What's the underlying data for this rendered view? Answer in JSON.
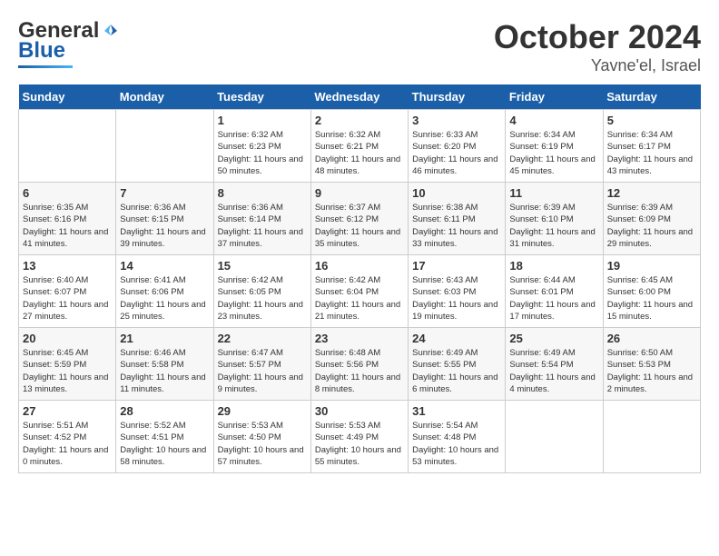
{
  "header": {
    "logo_general": "General",
    "logo_blue": "Blue",
    "month": "October 2024",
    "location": "Yavne'el, Israel"
  },
  "columns": [
    "Sunday",
    "Monday",
    "Tuesday",
    "Wednesday",
    "Thursday",
    "Friday",
    "Saturday"
  ],
  "weeks": [
    [
      {
        "day": "",
        "info": ""
      },
      {
        "day": "",
        "info": ""
      },
      {
        "day": "1",
        "info": "Sunrise: 6:32 AM\nSunset: 6:23 PM\nDaylight: 11 hours and 50 minutes."
      },
      {
        "day": "2",
        "info": "Sunrise: 6:32 AM\nSunset: 6:21 PM\nDaylight: 11 hours and 48 minutes."
      },
      {
        "day": "3",
        "info": "Sunrise: 6:33 AM\nSunset: 6:20 PM\nDaylight: 11 hours and 46 minutes."
      },
      {
        "day": "4",
        "info": "Sunrise: 6:34 AM\nSunset: 6:19 PM\nDaylight: 11 hours and 45 minutes."
      },
      {
        "day": "5",
        "info": "Sunrise: 6:34 AM\nSunset: 6:17 PM\nDaylight: 11 hours and 43 minutes."
      }
    ],
    [
      {
        "day": "6",
        "info": "Sunrise: 6:35 AM\nSunset: 6:16 PM\nDaylight: 11 hours and 41 minutes."
      },
      {
        "day": "7",
        "info": "Sunrise: 6:36 AM\nSunset: 6:15 PM\nDaylight: 11 hours and 39 minutes."
      },
      {
        "day": "8",
        "info": "Sunrise: 6:36 AM\nSunset: 6:14 PM\nDaylight: 11 hours and 37 minutes."
      },
      {
        "day": "9",
        "info": "Sunrise: 6:37 AM\nSunset: 6:12 PM\nDaylight: 11 hours and 35 minutes."
      },
      {
        "day": "10",
        "info": "Sunrise: 6:38 AM\nSunset: 6:11 PM\nDaylight: 11 hours and 33 minutes."
      },
      {
        "day": "11",
        "info": "Sunrise: 6:39 AM\nSunset: 6:10 PM\nDaylight: 11 hours and 31 minutes."
      },
      {
        "day": "12",
        "info": "Sunrise: 6:39 AM\nSunset: 6:09 PM\nDaylight: 11 hours and 29 minutes."
      }
    ],
    [
      {
        "day": "13",
        "info": "Sunrise: 6:40 AM\nSunset: 6:07 PM\nDaylight: 11 hours and 27 minutes."
      },
      {
        "day": "14",
        "info": "Sunrise: 6:41 AM\nSunset: 6:06 PM\nDaylight: 11 hours and 25 minutes."
      },
      {
        "day": "15",
        "info": "Sunrise: 6:42 AM\nSunset: 6:05 PM\nDaylight: 11 hours and 23 minutes."
      },
      {
        "day": "16",
        "info": "Sunrise: 6:42 AM\nSunset: 6:04 PM\nDaylight: 11 hours and 21 minutes."
      },
      {
        "day": "17",
        "info": "Sunrise: 6:43 AM\nSunset: 6:03 PM\nDaylight: 11 hours and 19 minutes."
      },
      {
        "day": "18",
        "info": "Sunrise: 6:44 AM\nSunset: 6:01 PM\nDaylight: 11 hours and 17 minutes."
      },
      {
        "day": "19",
        "info": "Sunrise: 6:45 AM\nSunset: 6:00 PM\nDaylight: 11 hours and 15 minutes."
      }
    ],
    [
      {
        "day": "20",
        "info": "Sunrise: 6:45 AM\nSunset: 5:59 PM\nDaylight: 11 hours and 13 minutes."
      },
      {
        "day": "21",
        "info": "Sunrise: 6:46 AM\nSunset: 5:58 PM\nDaylight: 11 hours and 11 minutes."
      },
      {
        "day": "22",
        "info": "Sunrise: 6:47 AM\nSunset: 5:57 PM\nDaylight: 11 hours and 9 minutes."
      },
      {
        "day": "23",
        "info": "Sunrise: 6:48 AM\nSunset: 5:56 PM\nDaylight: 11 hours and 8 minutes."
      },
      {
        "day": "24",
        "info": "Sunrise: 6:49 AM\nSunset: 5:55 PM\nDaylight: 11 hours and 6 minutes."
      },
      {
        "day": "25",
        "info": "Sunrise: 6:49 AM\nSunset: 5:54 PM\nDaylight: 11 hours and 4 minutes."
      },
      {
        "day": "26",
        "info": "Sunrise: 6:50 AM\nSunset: 5:53 PM\nDaylight: 11 hours and 2 minutes."
      }
    ],
    [
      {
        "day": "27",
        "info": "Sunrise: 5:51 AM\nSunset: 4:52 PM\nDaylight: 11 hours and 0 minutes."
      },
      {
        "day": "28",
        "info": "Sunrise: 5:52 AM\nSunset: 4:51 PM\nDaylight: 10 hours and 58 minutes."
      },
      {
        "day": "29",
        "info": "Sunrise: 5:53 AM\nSunset: 4:50 PM\nDaylight: 10 hours and 57 minutes."
      },
      {
        "day": "30",
        "info": "Sunrise: 5:53 AM\nSunset: 4:49 PM\nDaylight: 10 hours and 55 minutes."
      },
      {
        "day": "31",
        "info": "Sunrise: 5:54 AM\nSunset: 4:48 PM\nDaylight: 10 hours and 53 minutes."
      },
      {
        "day": "",
        "info": ""
      },
      {
        "day": "",
        "info": ""
      }
    ]
  ]
}
